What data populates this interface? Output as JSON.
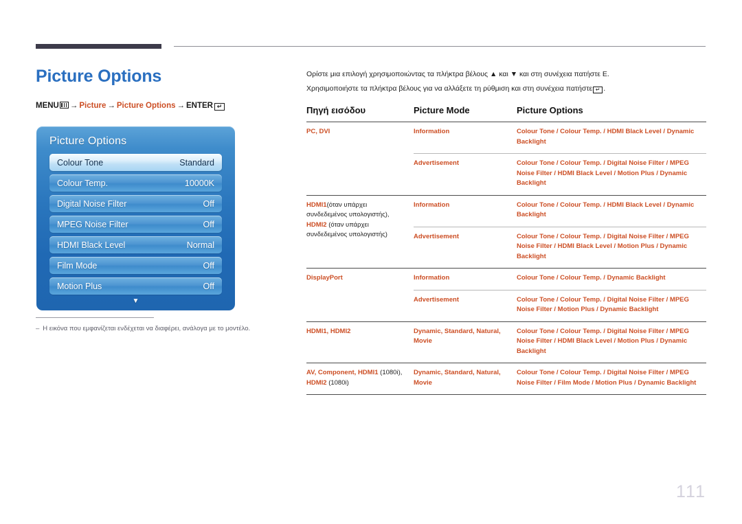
{
  "header": {
    "page_title": "Picture Options",
    "breadcrumb": {
      "menu_label": "MENU",
      "arrow": "→",
      "item1": "Picture",
      "item2": "Picture Options",
      "enter_label": "ENTER",
      "enter_glyph": "↵",
      "menu_glyph": "menu-icon"
    }
  },
  "osd": {
    "title": "Picture Options",
    "scroll_arrow": "▼",
    "rows": [
      {
        "label": "Colour Tone",
        "value": "Standard",
        "selected": true
      },
      {
        "label": "Colour Temp.",
        "value": "10000K",
        "selected": false
      },
      {
        "label": "Digital Noise Filter",
        "value": "Off",
        "selected": false
      },
      {
        "label": "MPEG Noise Filter",
        "value": "Off",
        "selected": false
      },
      {
        "label": "HDMI Black Level",
        "value": "Normal",
        "selected": false
      },
      {
        "label": "Film Mode",
        "value": "Off",
        "selected": false
      },
      {
        "label": "Motion Plus",
        "value": "Off",
        "selected": false
      }
    ]
  },
  "note": {
    "dash": "–",
    "text": "Η εικόνα που εμφανίζεται ενδέχεται να διαφέρει, ανάλογα με το μοντέλο."
  },
  "intro": {
    "line1": "Ορίστε μια επιλογή χρησιμοποιώντας τα πλήκτρα βέλους ▲ και ▼ και στη συνέχεια πατήστε E.",
    "line2_a": "Χρησιμοποιήστε τα πλήκτρα βέλους για να αλλάξετε τη ρύθμιση και στη συνέχεια πατήστε",
    "line2_glyph": "↵",
    "line2_b": "."
  },
  "table": {
    "headers": {
      "col1": "Πηγή εισόδου",
      "col2": "Picture Mode",
      "col3": "Picture Options"
    },
    "rows": [
      {
        "source": "PC, DVI",
        "source_suffix": "",
        "mode": "Information",
        "options": "Colour Tone / Colour Temp. / HDMI Black Level / Dynamic Backlight"
      },
      {
        "source": "",
        "mode": "Advertisement",
        "options": "Colour Tone / Colour Temp. / Digital Noise Filter / MPEG Noise Filter / HDMI Black Level / Motion Plus / Dynamic Backlight"
      },
      {
        "source_p1": "HDMI1",
        "source_p2": "(όταν υπάρχει συνδεδεμένος υπολογιστής),",
        "source_p3": "HDMI2",
        "source_p4": "(όταν υπάρχει συνδεδεμένος υπολογιστής)",
        "mode": "Information",
        "options": "Colour Tone / Colour Temp. / HDMI Black Level / Dynamic Backlight"
      },
      {
        "source": "",
        "mode": "Advertisement",
        "options": "Colour Tone / Colour Temp. / Digital Noise Filter / MPEG Noise Filter / HDMI Black Level / Motion Plus / Dynamic Backlight"
      },
      {
        "source": "DisplayPort",
        "mode": "Information",
        "options": "Colour Tone / Colour Temp. / Dynamic Backlight"
      },
      {
        "source": "",
        "mode": "Advertisement",
        "options": "Colour Tone / Colour Temp. / Digital Noise Filter / MPEG Noise Filter / Motion Plus / Dynamic Backlight"
      },
      {
        "source": "HDMI1, HDMI2",
        "mode": "Dynamic, Standard, Natural, Movie",
        "options": "Colour Tone / Colour Temp. / Digital Noise Filter / MPEG Noise Filter / HDMI Black Level / Motion Plus / Dynamic Backlight"
      },
      {
        "source_p1": "AV, Component, HDMI1",
        "source_p2": "(1080i),",
        "source_p3": "HDMI2",
        "source_p4": "(1080i)",
        "mode": "Dynamic, Standard, Natural, Movie",
        "options": "Colour Tone / Colour Temp. / Digital Noise Filter / MPEG Noise Filter / Film Mode / Motion Plus / Dynamic Backlight"
      }
    ]
  },
  "page_number": "111",
  "colors": {
    "heading_blue": "#2a6fc0",
    "accent_orange": "#cc4e24",
    "osd_blue": "#2a76bd",
    "rule_dark": "#3d3b4a"
  }
}
